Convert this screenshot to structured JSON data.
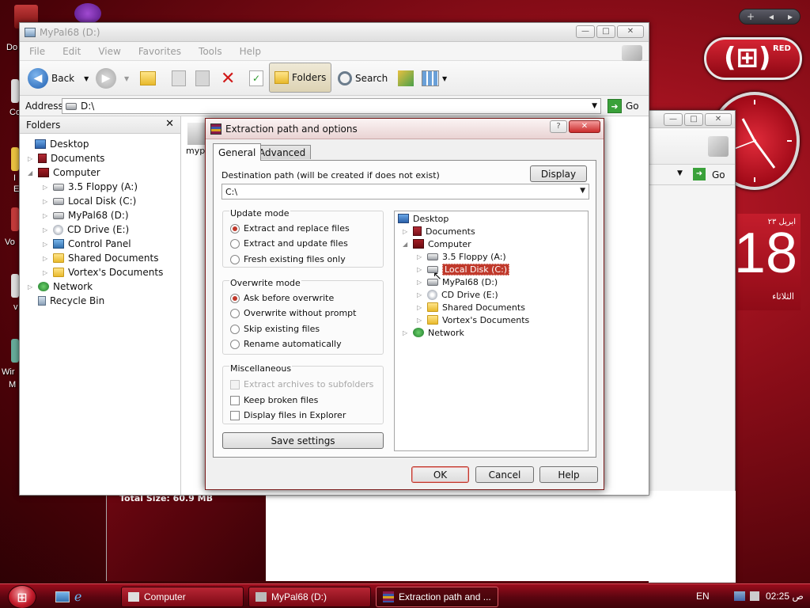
{
  "desktop": {
    "icon_labels": [
      "Do",
      "Co",
      "I",
      "E",
      "Vo",
      "v",
      "Wir",
      "M"
    ]
  },
  "gadgets": {
    "topbar_glyphs": [
      "+",
      "◂",
      "▸"
    ],
    "badge_logo": "(⊞)",
    "badge_label": "RED",
    "calendar_hijri": "ابريل ٢٣",
    "calendar_day": "18",
    "calendar_weekday": "الثلاثاء"
  },
  "explorer": {
    "title": "MyPal68 (D:)",
    "menu": [
      "File",
      "Edit",
      "View",
      "Favorites",
      "Tools",
      "Help"
    ],
    "toolbar": {
      "back": "Back",
      "folders": "Folders",
      "search": "Search"
    },
    "address_label": "Address",
    "address_value": "D:\\",
    "go_label": "Go",
    "folders_pane_title": "Folders",
    "tree": [
      {
        "label": "Desktop"
      },
      {
        "label": "Documents"
      },
      {
        "label": "Computer"
      },
      {
        "label": "3.5 Floppy (A:)"
      },
      {
        "label": "Local Disk (C:)"
      },
      {
        "label": "MyPal68 (D:)"
      },
      {
        "label": "CD Drive (E:)"
      },
      {
        "label": "Control Panel"
      },
      {
        "label": "Shared Documents"
      },
      {
        "label": "Vortex's Documents"
      },
      {
        "label": "Network"
      },
      {
        "label": "Recycle Bin"
      }
    ],
    "content_fragment": "myp",
    "status_total": "Total Size: 60.9 MB"
  },
  "second_window": {
    "go_label": "Go"
  },
  "dialog": {
    "title": "Extraction path and options",
    "help_btn": "?",
    "close_btn": "✕",
    "tabs": [
      "General",
      "Advanced"
    ],
    "destination_label": "Destination path (will be created if does not exist)",
    "display_button": "Display",
    "destination_value": "C:\\",
    "update_mode": {
      "title": "Update mode",
      "options": [
        "Extract and replace files",
        "Extract and update files",
        "Fresh existing files only"
      ],
      "selected": 0
    },
    "overwrite_mode": {
      "title": "Overwrite mode",
      "options": [
        "Ask before overwrite",
        "Overwrite without prompt",
        "Skip existing files",
        "Rename automatically"
      ],
      "selected": 0
    },
    "misc": {
      "title": "Miscellaneous",
      "options": [
        "Extract archives to subfolders",
        "Keep broken files",
        "Display files in Explorer"
      ]
    },
    "save_settings": "Save settings",
    "tree": [
      {
        "label": "Desktop"
      },
      {
        "label": "Documents"
      },
      {
        "label": "Computer"
      },
      {
        "label": "3.5 Floppy (A:)"
      },
      {
        "label": "Local Disk (C:)"
      },
      {
        "label": "MyPal68 (D:)"
      },
      {
        "label": "CD Drive (E:)"
      },
      {
        "label": "Shared Documents"
      },
      {
        "label": "Vortex's Documents"
      },
      {
        "label": "Network"
      }
    ],
    "selected_tree_item": "Local Disk (C:)",
    "ok": "OK",
    "cancel": "Cancel",
    "help": "Help"
  },
  "taskbar": {
    "start_glyph": "⊞",
    "buttons": [
      {
        "label": "Computer"
      },
      {
        "label": "MyPal68 (D:)"
      },
      {
        "label": "Extraction path and ..."
      }
    ],
    "lang": "EN",
    "clock": "02:25 ص"
  },
  "colors": {
    "accent_red": "#c41d2c",
    "selection": "#c0392b"
  }
}
